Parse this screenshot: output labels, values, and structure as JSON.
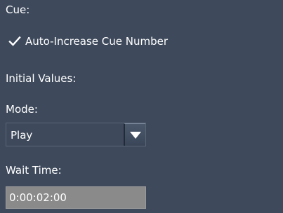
{
  "cue_section": {
    "heading": "Cue:",
    "auto_increase": {
      "label": "Auto-Increase Cue Number",
      "checked": true
    }
  },
  "initial_values": {
    "heading": "Initial Values:",
    "mode": {
      "label": "Mode:",
      "selected": "Play"
    },
    "wait_time": {
      "label": "Wait Time:",
      "value": "0:00:02:00"
    }
  },
  "colors": {
    "background": "#3e4a5c",
    "text": "#ffffff",
    "field_background": "#8a8a8a"
  },
  "icons": {
    "checkbox": "checkmark-icon",
    "dropdown": "triangle-down-icon"
  }
}
